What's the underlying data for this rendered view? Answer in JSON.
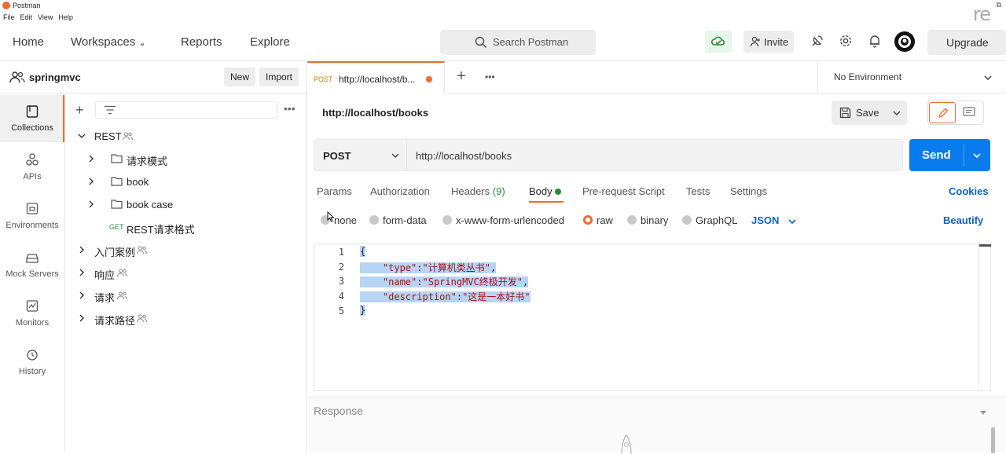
{
  "app": {
    "title": "Postman",
    "menu": [
      "File",
      "Edit",
      "View",
      "Help"
    ],
    "watermark": "re"
  },
  "header": {
    "nav": [
      "Home",
      "Workspaces",
      "Reports",
      "Explore"
    ],
    "search_placeholder": "Search Postman",
    "invite_label": "Invite",
    "upgrade_label": "Upgrade"
  },
  "workspace": {
    "name": "springmvc",
    "new_label": "New",
    "import_label": "Import"
  },
  "sidebar": {
    "items": [
      {
        "label": "Collections"
      },
      {
        "label": "APIs"
      },
      {
        "label": "Environments"
      },
      {
        "label": "Mock Servers"
      },
      {
        "label": "Monitors"
      },
      {
        "label": "History"
      }
    ]
  },
  "tree": {
    "root": "REST",
    "children": [
      {
        "label": "请求模式"
      },
      {
        "label": "book"
      },
      {
        "label": "book case"
      }
    ],
    "request": {
      "method": "GET",
      "label": "REST请求格式"
    },
    "collections": [
      "入门案例",
      "响应",
      "请求",
      "请求路径"
    ]
  },
  "tab": {
    "method": "POST",
    "title": "http://localhost/b..."
  },
  "environment": "No Environment",
  "request": {
    "title": "http://localhost/books",
    "save_label": "Save",
    "method": "POST",
    "url": "http://localhost/books",
    "send_label": "Send"
  },
  "request_tabs": {
    "params": "Params",
    "authorization": "Authorization",
    "headers": "Headers",
    "headers_count": "(9)",
    "body": "Body",
    "prerequest": "Pre-request Script",
    "tests": "Tests",
    "settings": "Settings",
    "cookies": "Cookies"
  },
  "body_types": {
    "none": "none",
    "form_data": "form-data",
    "urlencoded": "x-www-form-urlencoded",
    "raw": "raw",
    "binary": "binary",
    "graphql": "GraphQL",
    "format": "JSON",
    "beautify": "Beautify"
  },
  "editor": {
    "line_numbers": [
      "1",
      "2",
      "3",
      "4",
      "5"
    ],
    "open_brace": "{",
    "close_brace": "}",
    "fields": [
      {
        "key": "\"type\"",
        "value": "\"计算机类丛书\"",
        "sep": ":",
        "end": ","
      },
      {
        "key": "\"name\"",
        "value": "\"SpringMVC终极开发\"",
        "sep": ":",
        "end": ","
      },
      {
        "key": "\"description\"",
        "value": "\"这是一本好书\"",
        "sep": ":",
        "end": ""
      }
    ]
  },
  "response": {
    "label": "Response"
  },
  "colors": {
    "accent": "#ef6c31",
    "primary": "#097bed",
    "link": "#0b63c4"
  }
}
